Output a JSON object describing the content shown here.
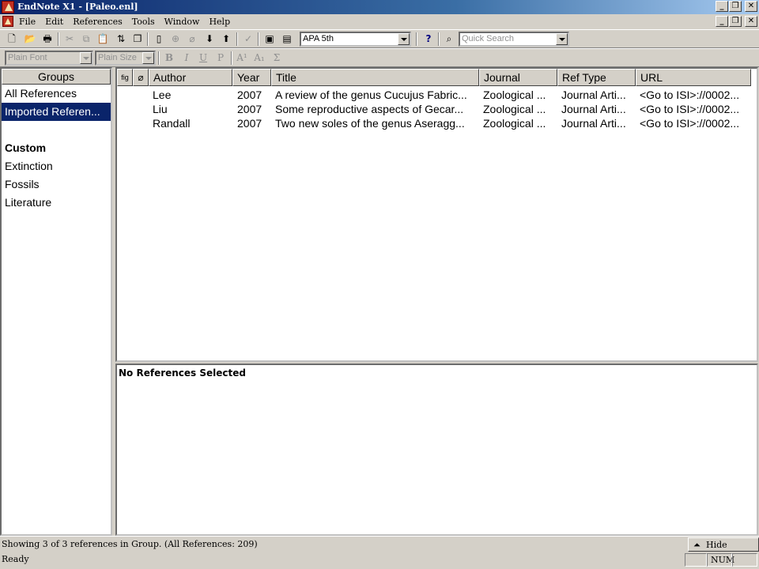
{
  "window": {
    "title": "EndNote X1 - [Paleo.enl]",
    "minimize": "_",
    "restore": "❐",
    "close": "✕"
  },
  "menubar": {
    "items": [
      "File",
      "Edit",
      "References",
      "Tools",
      "Window",
      "Help"
    ]
  },
  "toolbar": {
    "style_value": "APA 5th",
    "help_label": "?",
    "quick_search_placeholder": "Quick Search",
    "buttons": {
      "new": "🗋",
      "open": "📂",
      "print": "🖶",
      "cut": "✂",
      "copy": "⧉",
      "paste": "📋",
      "sort": "⇅",
      "copy_formatted": "❐",
      "show_selected": "▯",
      "search_online": "⊕",
      "attach": "⌀",
      "insert_citation": "⬇",
      "format_bibliography": "⬆",
      "spellcheck": "✓",
      "insert_picture": "▣",
      "window_split": "▤",
      "find": "⌕"
    }
  },
  "format_toolbar": {
    "font_placeholder": "Plain Font",
    "size_placeholder": "Plain Size",
    "bold": "B",
    "italic": "I",
    "underline": "U",
    "plain": "P",
    "superscript": "A¹",
    "subscript": "A₁",
    "symbol": "Σ"
  },
  "groups": {
    "header": "Groups",
    "all_references": "All References",
    "imported": "Imported Referen...",
    "custom_heading": "Custom",
    "custom_items": [
      "Extinction",
      "Fossils",
      "Literature"
    ]
  },
  "reference_list": {
    "columns": {
      "figure": "fig",
      "attachment": "⌀",
      "author": "Author",
      "year": "Year",
      "title": "Title",
      "journal": "Journal",
      "ref_type": "Ref Type",
      "url": "URL"
    },
    "rows": [
      {
        "author": "Lee",
        "year": "2007",
        "title": "A review of the genus Cucujus Fabric...",
        "journal": "Zoological ...",
        "ref_type": "Journal Arti...",
        "url": "<Go to ISI>://0002..."
      },
      {
        "author": "Liu",
        "year": "2007",
        "title": "Some reproductive aspects of Gecar...",
        "journal": "Zoological ...",
        "ref_type": "Journal Arti...",
        "url": "<Go to ISI>://0002..."
      },
      {
        "author": "Randall",
        "year": "2007",
        "title": "Two new soles of the genus Aseragg...",
        "journal": "Zoological ...",
        "ref_type": "Journal Arti...",
        "url": "<Go to ISI>://0002..."
      }
    ]
  },
  "preview": {
    "text": "No References Selected"
  },
  "status": {
    "group_info": "Showing 3 of 3 references in Group. (All References: 209)",
    "hide_preview_icon": "⏶",
    "hide_preview": "Hide Preview",
    "ready": "Ready",
    "num": "NUM"
  }
}
